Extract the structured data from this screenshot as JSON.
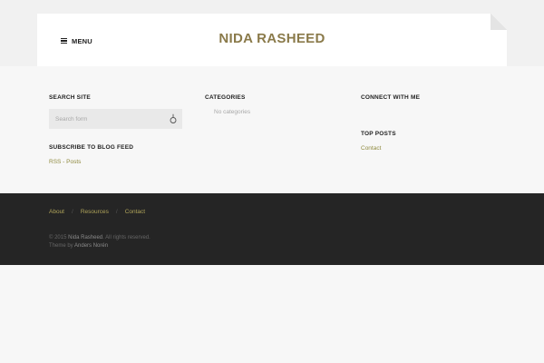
{
  "header": {
    "menu_label": "MENU",
    "site_title": "NIDA RASHEED"
  },
  "widgets": {
    "search": {
      "title": "SEARCH SITE",
      "placeholder": "Search form"
    },
    "categories": {
      "title": "CATEGORIES",
      "empty_text": "No categories"
    },
    "connect": {
      "title": "CONNECT WITH ME"
    },
    "subscribe": {
      "title": "SUBSCRIBE TO BLOG FEED",
      "link": "RSS - Posts"
    },
    "top_posts": {
      "title": "TOP POSTS",
      "link": "Contact"
    }
  },
  "footer": {
    "nav": [
      "About",
      "Resources",
      "Contact"
    ],
    "separator": "/",
    "copyright_prefix": "© 2015",
    "copyright_name": "Nida Rasheed",
    "copyright_suffix": ". All rights reserved.",
    "theme_prefix": "Theme by",
    "theme_author": "Anders Norén"
  },
  "colors": {
    "title": "#8a7a4a",
    "link": "#8f8a3f",
    "footer_bg": "#252525"
  }
}
